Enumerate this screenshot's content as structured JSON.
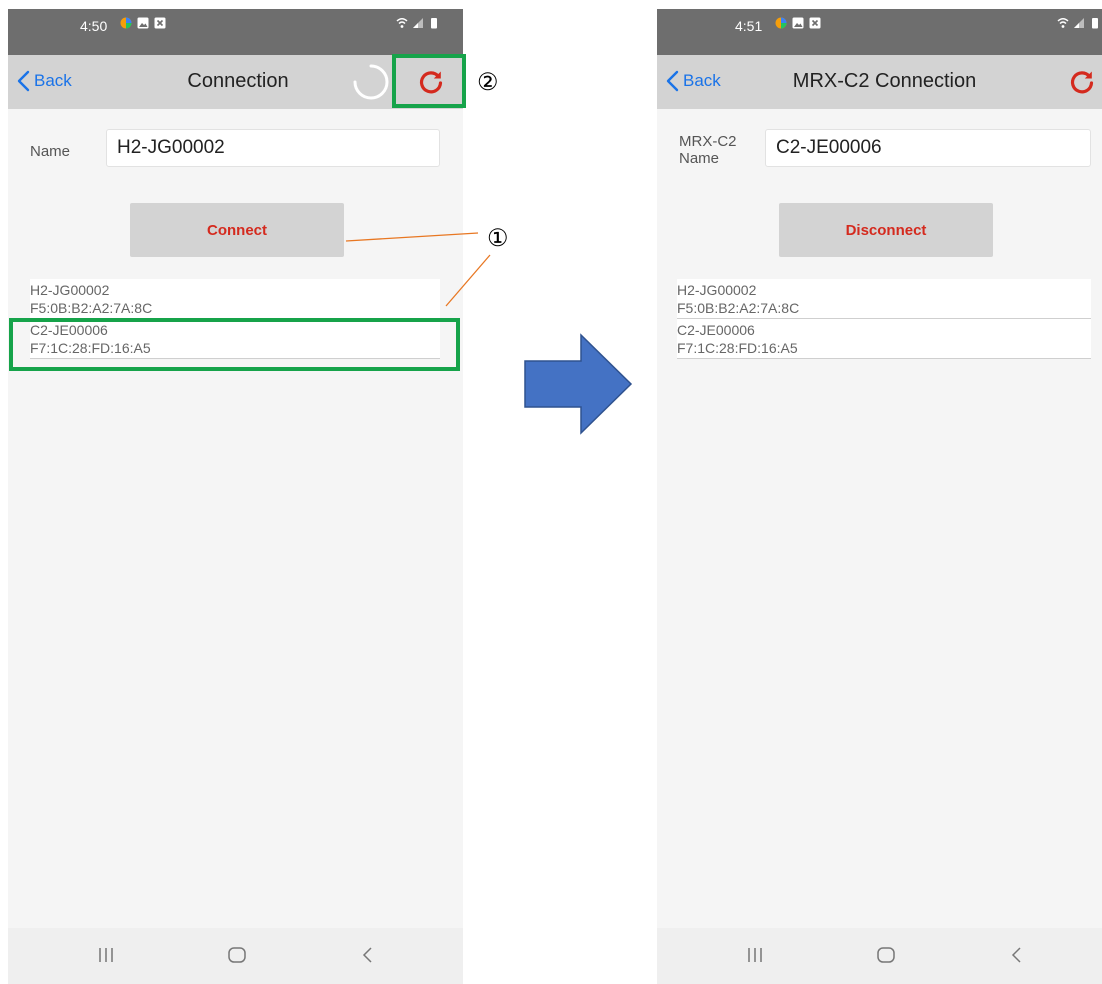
{
  "left": {
    "status_time": "4:50",
    "back_label": "Back",
    "title": "Connection",
    "name_label": "Name",
    "name_value": "H2-JG00002",
    "button_label": "Connect",
    "devices": [
      {
        "name": "H2-JG00002",
        "mac": "F5:0B:B2:A2:7A:8C"
      },
      {
        "name": "C2-JE00006",
        "mac": "F7:1C:28:FD:16:A5"
      }
    ]
  },
  "right": {
    "status_time": "4:51",
    "back_label": "Back",
    "title": "MRX-C2 Connection",
    "name_label_line1": "MRX-C2",
    "name_label_line2": "Name",
    "name_value": "C2-JE00006",
    "button_label": "Disconnect",
    "devices": [
      {
        "name": "H2-JG00002",
        "mac": "F5:0B:B2:A2:7A:8C"
      },
      {
        "name": "C2-JE00006",
        "mac": "F7:1C:28:FD:16:A5"
      }
    ]
  },
  "annotations": {
    "marker_1": "①",
    "marker_2": "②"
  },
  "colors": {
    "accent_blue": "#1a73e8",
    "button_text_red": "#d42a1e",
    "highlight_green": "#16a34a",
    "arrow_blue": "#4472c4",
    "connector_orange": "#e87722"
  },
  "icons": [
    "chevron-left-icon",
    "refresh-icon",
    "spinner-icon",
    "recent-apps-icon",
    "home-icon",
    "back-nav-icon",
    "wifi-icon",
    "signal-icon",
    "battery-icon",
    "right-arrow-icon"
  ]
}
